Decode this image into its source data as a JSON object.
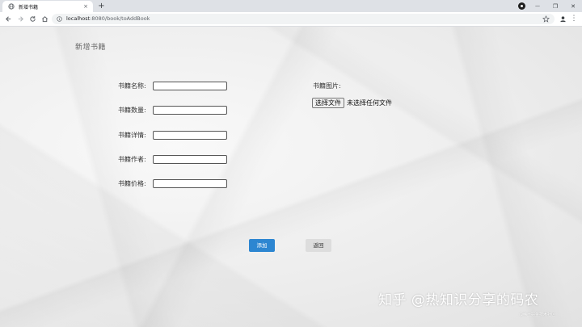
{
  "browser": {
    "tab_title": "新增书籍",
    "tab_close": "×",
    "new_tab": "+",
    "url_host": "localhost",
    "url_path": ":8080/book/toAddBook",
    "window_minimize": "—",
    "window_maximize": "❐",
    "window_close": "✕",
    "menu": "⋮"
  },
  "page": {
    "title": "新增书籍",
    "fields": [
      {
        "label": "书籍名称:",
        "value": "",
        "placeholder": ""
      },
      {
        "label": "书籍数量:",
        "value": "",
        "placeholder": ""
      },
      {
        "label": "书籍详情:",
        "value": "",
        "placeholder": ""
      },
      {
        "label": "书籍作者:",
        "value": "",
        "placeholder": ""
      },
      {
        "label": "书籍价格:",
        "value": "",
        "placeholder": ""
      }
    ],
    "image_label": "书籍图片:",
    "file_button": "选择文件",
    "file_status": "未选择任何文件",
    "add_button": "添加",
    "back_button": "返回"
  },
  "watermark": {
    "main": "知乎 @热知识分享的码农",
    "small": "@稀土掘金技术社区"
  },
  "colors": {
    "accent": "#2d86d1",
    "back_button": "#dddddd"
  }
}
